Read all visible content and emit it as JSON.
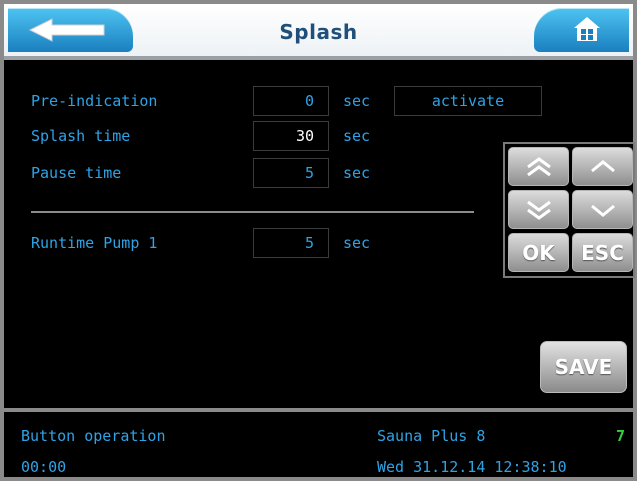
{
  "header": {
    "title": "Splash",
    "back_icon": "back-arrow-icon",
    "home_icon": "home-icon"
  },
  "settings": [
    {
      "label": "Pre-indication",
      "value": "0",
      "unit": "sec"
    },
    {
      "label": "Splash time",
      "value": "30",
      "unit": "sec"
    },
    {
      "label": "Pause time",
      "value": "5",
      "unit": "sec"
    },
    {
      "label": "Runtime Pump 1",
      "value": "5",
      "unit": "sec"
    }
  ],
  "activate_label": "activate",
  "keypad": {
    "page_up": "page-up-icon",
    "up": "up-icon",
    "page_down": "page-down-icon",
    "down": "down-icon",
    "ok": "OK",
    "esc": "ESC"
  },
  "save_label": "SAVE",
  "status": {
    "mode": "Button operation",
    "product": "Sauna Plus 8",
    "number": "7",
    "timer": "00:00",
    "datetime": "Wed 31.12.14 12:38:10"
  },
  "colors": {
    "text": "#2ea3e6",
    "header_button": "#2a9ad8",
    "status_ok": "#35d13b"
  }
}
